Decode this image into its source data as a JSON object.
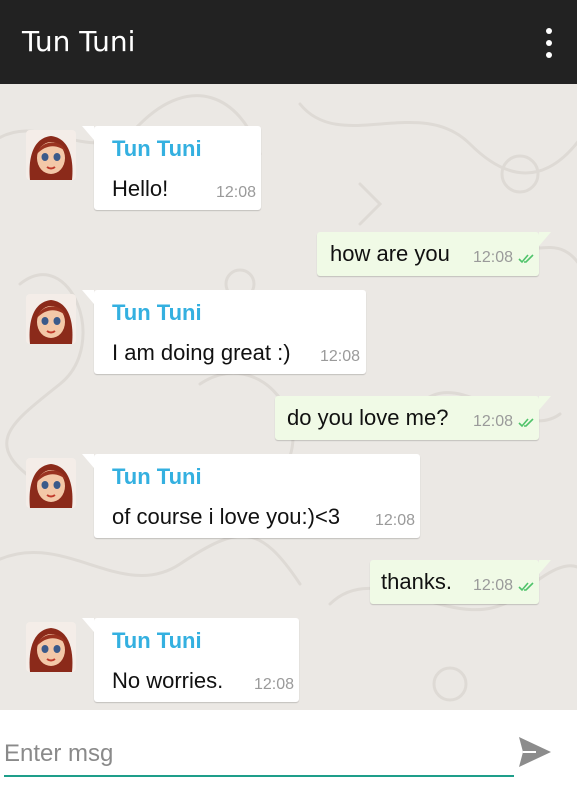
{
  "app_bar": {
    "title": "Tun Tuni",
    "menu_icon": "overflow-menu-icon"
  },
  "colors": {
    "app_bar": "#222222",
    "sender_name": "#34b0e0",
    "incoming_bubble": "#ffffff",
    "outgoing_bubble": "#f0fae6",
    "read_ticks": "#4fc36a",
    "input_underline": "#1e9e8a"
  },
  "messages": [
    {
      "direction": "in",
      "sender": "Tun Tuni",
      "text": "Hello!",
      "time": "12:08"
    },
    {
      "direction": "out",
      "text": "how are you",
      "time": "12:08",
      "status": "read"
    },
    {
      "direction": "in",
      "sender": "Tun Tuni",
      "text": "I am doing great :)",
      "time": "12:08"
    },
    {
      "direction": "out",
      "text": "do you love me?",
      "time": "12:08",
      "status": "read"
    },
    {
      "direction": "in",
      "sender": "Tun Tuni",
      "text": "of course i love you:)<3",
      "time": "12:08"
    },
    {
      "direction": "out",
      "text": "thanks.",
      "time": "12:08",
      "status": "read"
    },
    {
      "direction": "in",
      "sender": "Tun Tuni",
      "text": "No worries.",
      "time": "12:08"
    }
  ],
  "composer": {
    "placeholder": "Enter msg",
    "value": "",
    "send_icon": "send-icon"
  }
}
